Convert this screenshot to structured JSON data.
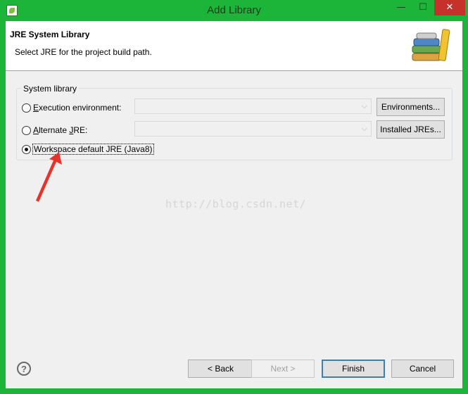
{
  "window": {
    "title": "Add Library",
    "minimize_glyph": "—",
    "maximize_glyph": "☐",
    "close_glyph": "✕"
  },
  "header": {
    "title": "JRE System Library",
    "subtitle": "Select JRE for the project build path."
  },
  "group": {
    "label": "System library",
    "options": [
      {
        "label_pre": "",
        "label_key": "E",
        "label_post": "xecution environment:",
        "selected": false
      },
      {
        "label_pre": "",
        "label_key": "A",
        "label_post": "lternate ",
        "label_key2": "J",
        "label_post2": "RE:",
        "selected": false
      },
      {
        "label": "Workspace default JRE (Java8)",
        "selected": true
      }
    ],
    "env_combo_value": "",
    "jre_combo_value": "",
    "environments_button": "Environments...",
    "installed_jres_button": "Installed JREs..."
  },
  "watermark": "http://blog.csdn.net/",
  "footer": {
    "help_glyph": "?",
    "back_button": "< Back",
    "next_button": "Next >",
    "finish_button": "Finish",
    "cancel_button": "Cancel"
  },
  "colors": {
    "frame": "#1db43a",
    "close_button": "#c7312b",
    "annotation_arrow": "#e8322a"
  }
}
